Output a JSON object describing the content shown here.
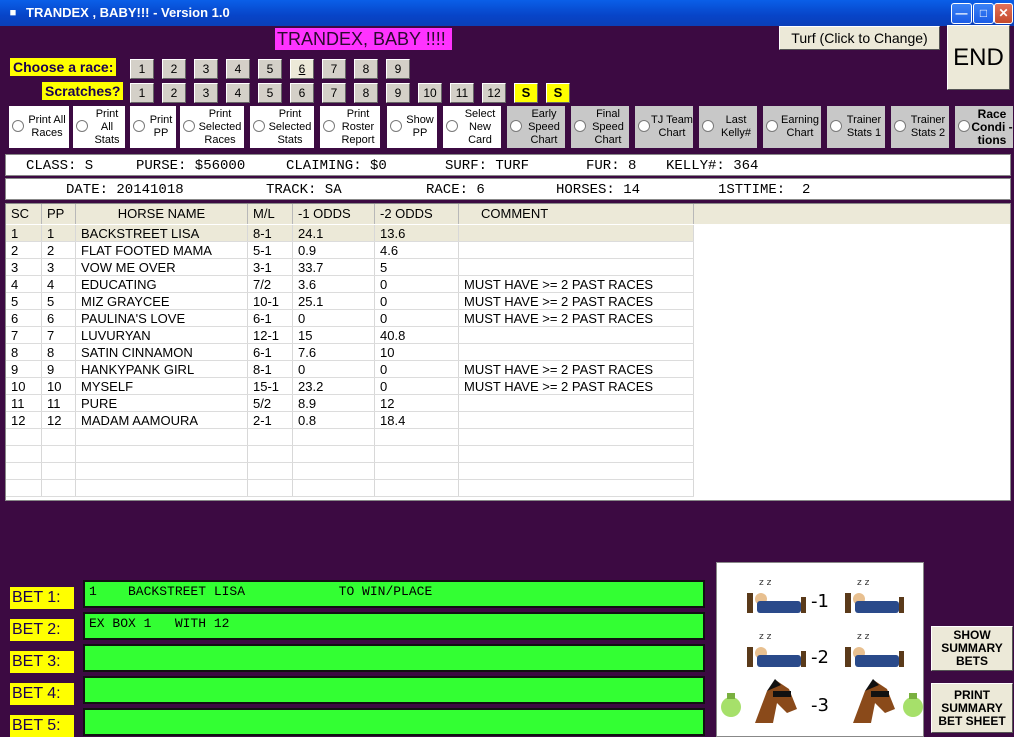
{
  "window": {
    "title": "TRANDEX , BABY!!! - Version 1.0"
  },
  "banner": "TRANDEX, BABY !!!!",
  "turf_button": "Turf (Click to Change)",
  "end_button": "END",
  "race_selector": {
    "label": "Choose  a race:",
    "numbers": [
      "1",
      "2",
      "3",
      "4",
      "5",
      "6",
      "7",
      "8",
      "9"
    ],
    "selected": "6"
  },
  "scratches": {
    "label": "Scratches?",
    "numbers": [
      "1",
      "2",
      "3",
      "4",
      "5",
      "6",
      "7",
      "8",
      "9",
      "10",
      "11",
      "12"
    ],
    "s_buttons": [
      "S",
      "S"
    ]
  },
  "options": [
    {
      "label": "Print All Races"
    },
    {
      "label": "Print All Stats"
    },
    {
      "label": "Print PP"
    },
    {
      "label": "Print Selected Races"
    },
    {
      "label": "Print Selected Stats"
    },
    {
      "label": "Print Roster Report"
    },
    {
      "label": "Show PP"
    },
    {
      "label": "Select New Card"
    },
    {
      "label": "Early Speed Chart"
    },
    {
      "label": "Final Speed Chart"
    },
    {
      "label": "TJ Team Chart"
    },
    {
      "label": "Last Kelly#"
    },
    {
      "label": "Earning Chart"
    },
    {
      "label": "Trainer Stats 1"
    },
    {
      "label": "Trainer Stats 2"
    },
    {
      "label": "Race Condi -tions"
    }
  ],
  "race_info": {
    "class": "CLASS: S",
    "purse": "PURSE: $56000",
    "claiming": "CLAIMING: $0",
    "surf": "SURF: TURF",
    "fur": "FUR: 8",
    "kelly": "KELLY#: 364",
    "date": "DATE: 20141018",
    "track": "TRACK: SA",
    "race": "RACE: 6",
    "horses": "HORSES: 14",
    "firsttime": "1STTIME:  2"
  },
  "table": {
    "columns": [
      "SC",
      "PP",
      "HORSE NAME",
      "M/L",
      "-1 ODDS",
      "-2 ODDS",
      "COMMENT"
    ],
    "rows": [
      [
        "1",
        "1",
        "BACKSTREET LISA",
        "8-1",
        "24.1",
        "13.6",
        ""
      ],
      [
        "2",
        "2",
        "FLAT FOOTED MAMA",
        "5-1",
        "0.9",
        "4.6",
        ""
      ],
      [
        "3",
        "3",
        "VOW ME OVER",
        "3-1",
        "33.7",
        "5",
        ""
      ],
      [
        "4",
        "4",
        "EDUCATING",
        "7/2",
        "3.6",
        "0",
        "MUST HAVE >= 2 PAST RACES"
      ],
      [
        "5",
        "5",
        "MIZ GRAYCEE",
        "10-1",
        "25.1",
        "0",
        "MUST HAVE >= 2 PAST RACES"
      ],
      [
        "6",
        "6",
        "PAULINA'S LOVE",
        "6-1",
        "0",
        "0",
        "MUST HAVE >= 2 PAST RACES"
      ],
      [
        "7",
        "7",
        "LUVURYAN",
        "12-1",
        "15",
        "40.8",
        ""
      ],
      [
        "8",
        "8",
        "SATIN CINNAMON",
        "6-1",
        "7.6",
        "10",
        ""
      ],
      [
        "9",
        "9",
        "HANKYPANK GIRL",
        "8-1",
        "0",
        "0",
        "MUST HAVE >= 2 PAST RACES"
      ],
      [
        "10",
        "10",
        "MYSELF",
        "15-1",
        "23.2",
        "0",
        "MUST HAVE >= 2 PAST RACES"
      ],
      [
        "11",
        "11",
        "PURE",
        "5/2",
        "8.9",
        "12",
        ""
      ],
      [
        "12",
        "12",
        "MADAM AAMOURA",
        "2-1",
        "0.8",
        "18.4",
        ""
      ]
    ]
  },
  "bets": [
    {
      "label": "BET 1:",
      "value": "1    BACKSTREET LISA            TO WIN/PLACE"
    },
    {
      "label": "BET 2:",
      "value": "EX BOX 1   WITH 12"
    },
    {
      "label": "BET 3:",
      "value": ""
    },
    {
      "label": "BET 4:",
      "value": ""
    },
    {
      "label": "BET 5:",
      "value": ""
    }
  ],
  "sleep_numbers": [
    "-1",
    "-2",
    "-3"
  ],
  "summary_buttons": {
    "show": "SHOW SUMMARY BETS",
    "print": "PRINT SUMMARY BET SHEET"
  }
}
